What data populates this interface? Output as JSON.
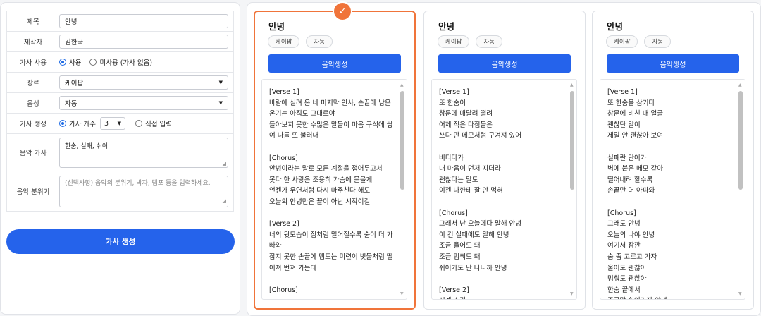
{
  "form": {
    "title": {
      "label": "제목",
      "value": "안녕"
    },
    "maker": {
      "label": "제작자",
      "value": "김한국"
    },
    "lyrics_use": {
      "label": "가사 사용",
      "opt_use": "사용",
      "opt_none": "미사용 (가사 없음)",
      "selected": "사용"
    },
    "genre": {
      "label": "장르",
      "value": "케이팝"
    },
    "voice": {
      "label": "음성",
      "value": "자동"
    },
    "lyrics_gen": {
      "label": "가사 생성",
      "opt_count": "가사 개수",
      "count": "3",
      "opt_direct": "직접 입력",
      "selected": "가사 개수"
    },
    "music_lyrics": {
      "label": "음악 가사",
      "value": "한숨, 실패, 쉬어"
    },
    "music_mood": {
      "label": "음악 분위기",
      "placeholder": "(선택사항) 음악의 분위기, 박자, 템포 등을 입력하세요."
    },
    "generate_button": "가사 생성"
  },
  "results": [
    {
      "title": "안녕",
      "tags": [
        "케이팝",
        "자동"
      ],
      "button": "음악생성",
      "selected": true,
      "lyrics": "[Verse 1]\n바람에 실려 온 네 마지막 인사, 손끝에 남은 온기는 아직도 그대로야\n들아보지 못한 수많은 말들이 마음 구석에 쌓여 나를 또 불러내\n\n[Chorus]\n안녕이라는 말로 모든 계절을 접어두고서\n못다 한 사랑은 조용히 가슴에 묻을게\n언젠가 우연처럼 다시 마주친다 해도\n오늘의 안녕만은 끝이 아닌 시작이길\n\n[Verse 2]\n너의 뒷모습이 점처럼 멀어질수록 숨이 더 가빠와\n잡지 못한 손끝에 맴도는 미련이 빗물처럼 떨어져 번져 가는데\n\n[Chorus]"
    },
    {
      "title": "안녕",
      "tags": [
        "케이팝",
        "자동"
      ],
      "button": "음악생성",
      "selected": false,
      "lyrics": "[Verse 1]\n또 한숨이\n창문에 매달려 떨려\n어제 적은 다짐들은\n쓰다 만 메모처럼 구겨져 있어\n\n버티다가\n내 마음이 먼저 지더라\n괜찮다는 말도\n이젠 나한테 잘 안 먹혀\n\n[Chorus]\n그래서 난 오늘에다 말해 안녕\n이 긴 실패에도 말해 안녕\n조금 울어도 돼\n조금 멈춰도 돼\n쉬어가도 난 나니까 안녕\n\n[Verse 2]\n시계 소리"
    },
    {
      "title": "안녕",
      "tags": [
        "케이팝",
        "자동"
      ],
      "button": "음악생성",
      "selected": false,
      "lyrics": "[Verse 1]\n또 한숨을 삼키다\n창문에 비친 내 얼굴\n괜찮단 말이\n제일 안 괜찮아 보여\n\n실패란 단어가\n벽에 붙은 메모 같아\n떨어내려 할수록\n손끝만 더 아파와\n\n[Chorus]\n그래도 안녕\n오늘의 나야 안녕\n여기서 잠깐\n숨 좀 고르고 가자\n울어도 괜찮아\n멈춰도 괜찮아\n한숨 끝에서\n조금만 쉬어가자 안녕"
    }
  ]
}
